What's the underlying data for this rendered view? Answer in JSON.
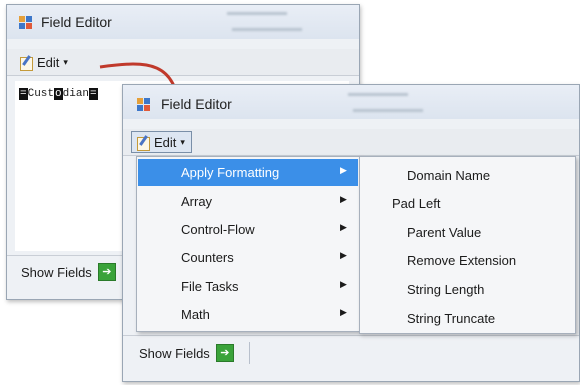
{
  "back_window": {
    "title": "Field Editor",
    "edit_label": "Edit",
    "edit_caret": "▾",
    "content_tokens": [
      "=",
      "Cust",
      "o",
      "dian",
      "="
    ],
    "show_fields_label": "Show Fields",
    "show_fields_arrow": "➔"
  },
  "front_window": {
    "title": "Field Editor",
    "edit_label": "Edit",
    "edit_caret": "▾",
    "show_fields_label": "Show Fields",
    "show_fields_arrow": "➔"
  },
  "menu": {
    "items": [
      {
        "label": "Apply Formatting",
        "arrow": "▶",
        "selected": true
      },
      {
        "label": "Array",
        "arrow": "▶"
      },
      {
        "label": "Control-Flow",
        "arrow": "▶"
      },
      {
        "label": "Counters",
        "arrow": "▶"
      },
      {
        "label": "File Tasks",
        "arrow": "▶"
      },
      {
        "label": "Math",
        "arrow": "▶"
      }
    ]
  },
  "submenu": {
    "items": [
      "Domain Name",
      "Pad Left",
      "Parent Value",
      "Remove Extension",
      "String Length",
      "String Truncate"
    ]
  },
  "colors": {
    "arrow": "#c0392b",
    "highlight": "#3b8fe8"
  }
}
